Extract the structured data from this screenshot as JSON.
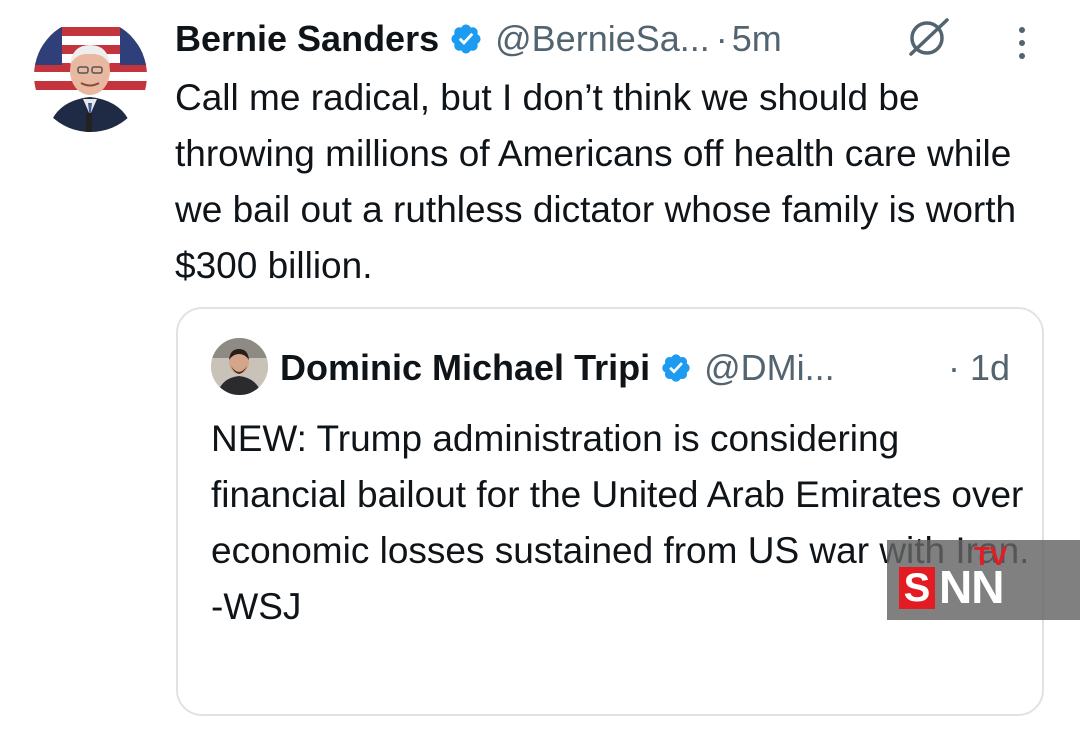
{
  "tweet": {
    "author_name": "Bernie Sanders",
    "handle": "@BernieSa...",
    "separator": "·",
    "time": "5m",
    "text": "Call me radical, but I don’t think we should be throwing millions of Americans off health care while we bail out a ruthless dictator whose family is worth $300 billion."
  },
  "quoted_tweet": {
    "author_name": "Dominic Michael Tripi",
    "handle": "@DMi...",
    "time": "· 1d",
    "text": "NEW: Trump administration is considering financial bailout for the United Arab Emirates over economic losses sustained from US war with Iran.\n-WSJ"
  },
  "watermark": {
    "s": "S",
    "nn": "NN",
    "tv": "TV"
  },
  "icons": {
    "verified": "verified-badge-icon",
    "grok": "grok-icon",
    "more": "more-options-icon"
  },
  "colors": {
    "text": "#0f1419",
    "secondary": "#536471",
    "verified_blue": "#1d9bf0",
    "border": "#dfe3e8",
    "watermark_red": "#e31b23"
  }
}
